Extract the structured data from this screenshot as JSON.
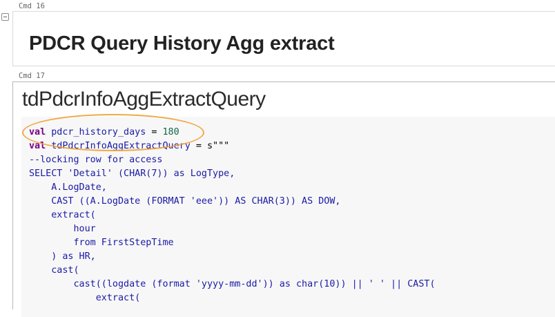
{
  "cells": [
    {
      "label": "Cmd 16",
      "heading": "PDCR Query History Agg extract"
    },
    {
      "label": "Cmd 17",
      "title": "tdPdcrInfoAggExtractQuery"
    }
  ],
  "code": {
    "l1": {
      "kw": "val",
      "name": "pdcr_history_days",
      "op": " = ",
      "num": "180"
    },
    "l2": {
      "kw": "val",
      "name": "tdPdcrInfoAggExtractQuery",
      "op": " = ",
      "str": "s\"\"\""
    },
    "l3": "--locking row for access",
    "l4": "SELECT 'Detail' (CHAR(7)) as LogType,",
    "l5": "    A.LogDate,",
    "l6": "    CAST ((A.LogDate (FORMAT 'eee')) AS CHAR(3)) AS DOW,",
    "l7": "    extract(",
    "l8": "        hour",
    "l9": "        from FirstStepTime",
    "l10": "    ) as HR,",
    "l11": "    cast(",
    "l12": "        cast((logdate (format 'yyyy-mm-dd')) as char(10)) || ' ' || CAST(",
    "l13": "            extract("
  },
  "colors": {
    "highlight": "#f0a030",
    "keyword": "#770088",
    "code": "#1a1aa6"
  }
}
